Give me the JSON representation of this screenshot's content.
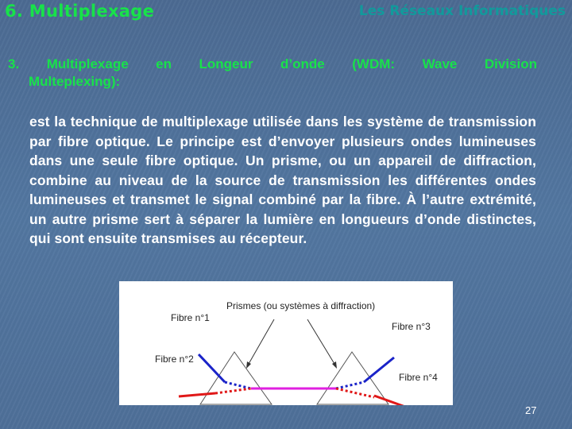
{
  "header": {
    "title": "6. Multiplexage",
    "course": "Les Réseaux Informatiques"
  },
  "section": {
    "heading_line1": "3. Multiplexage en Longeur d’onde (WDM: Wave Division",
    "heading_line2": "Multeplexing):"
  },
  "body": {
    "paragraph": "est la technique de multiplexage utilisée dans les système de transmission par fibre optique.  Le principe est d’envoyer plusieurs ondes lumineuses dans une seule fibre optique. Un prisme, ou un appareil de diffraction, combine au niveau de la source de transmission les différentes ondes lumineuses et transmet le signal combiné par la fibre. À l’autre extrémité, un autre prisme sert à séparer la lumière en longueurs d’onde distinctes, qui sont ensuite transmises au récepteur."
  },
  "diagram": {
    "caption": "Prismes (ou systèmes à diffraction)",
    "labels": {
      "fibre1": "Fibre n°1",
      "fibre2": "Fibre n°2",
      "fibre3": "Fibre n°3",
      "fibre4": "Fibre n°4"
    },
    "colors": {
      "blue": "#1a23c8",
      "red": "#e01818",
      "magenta": "#e020e0"
    }
  },
  "footer": {
    "page_number": "27"
  }
}
